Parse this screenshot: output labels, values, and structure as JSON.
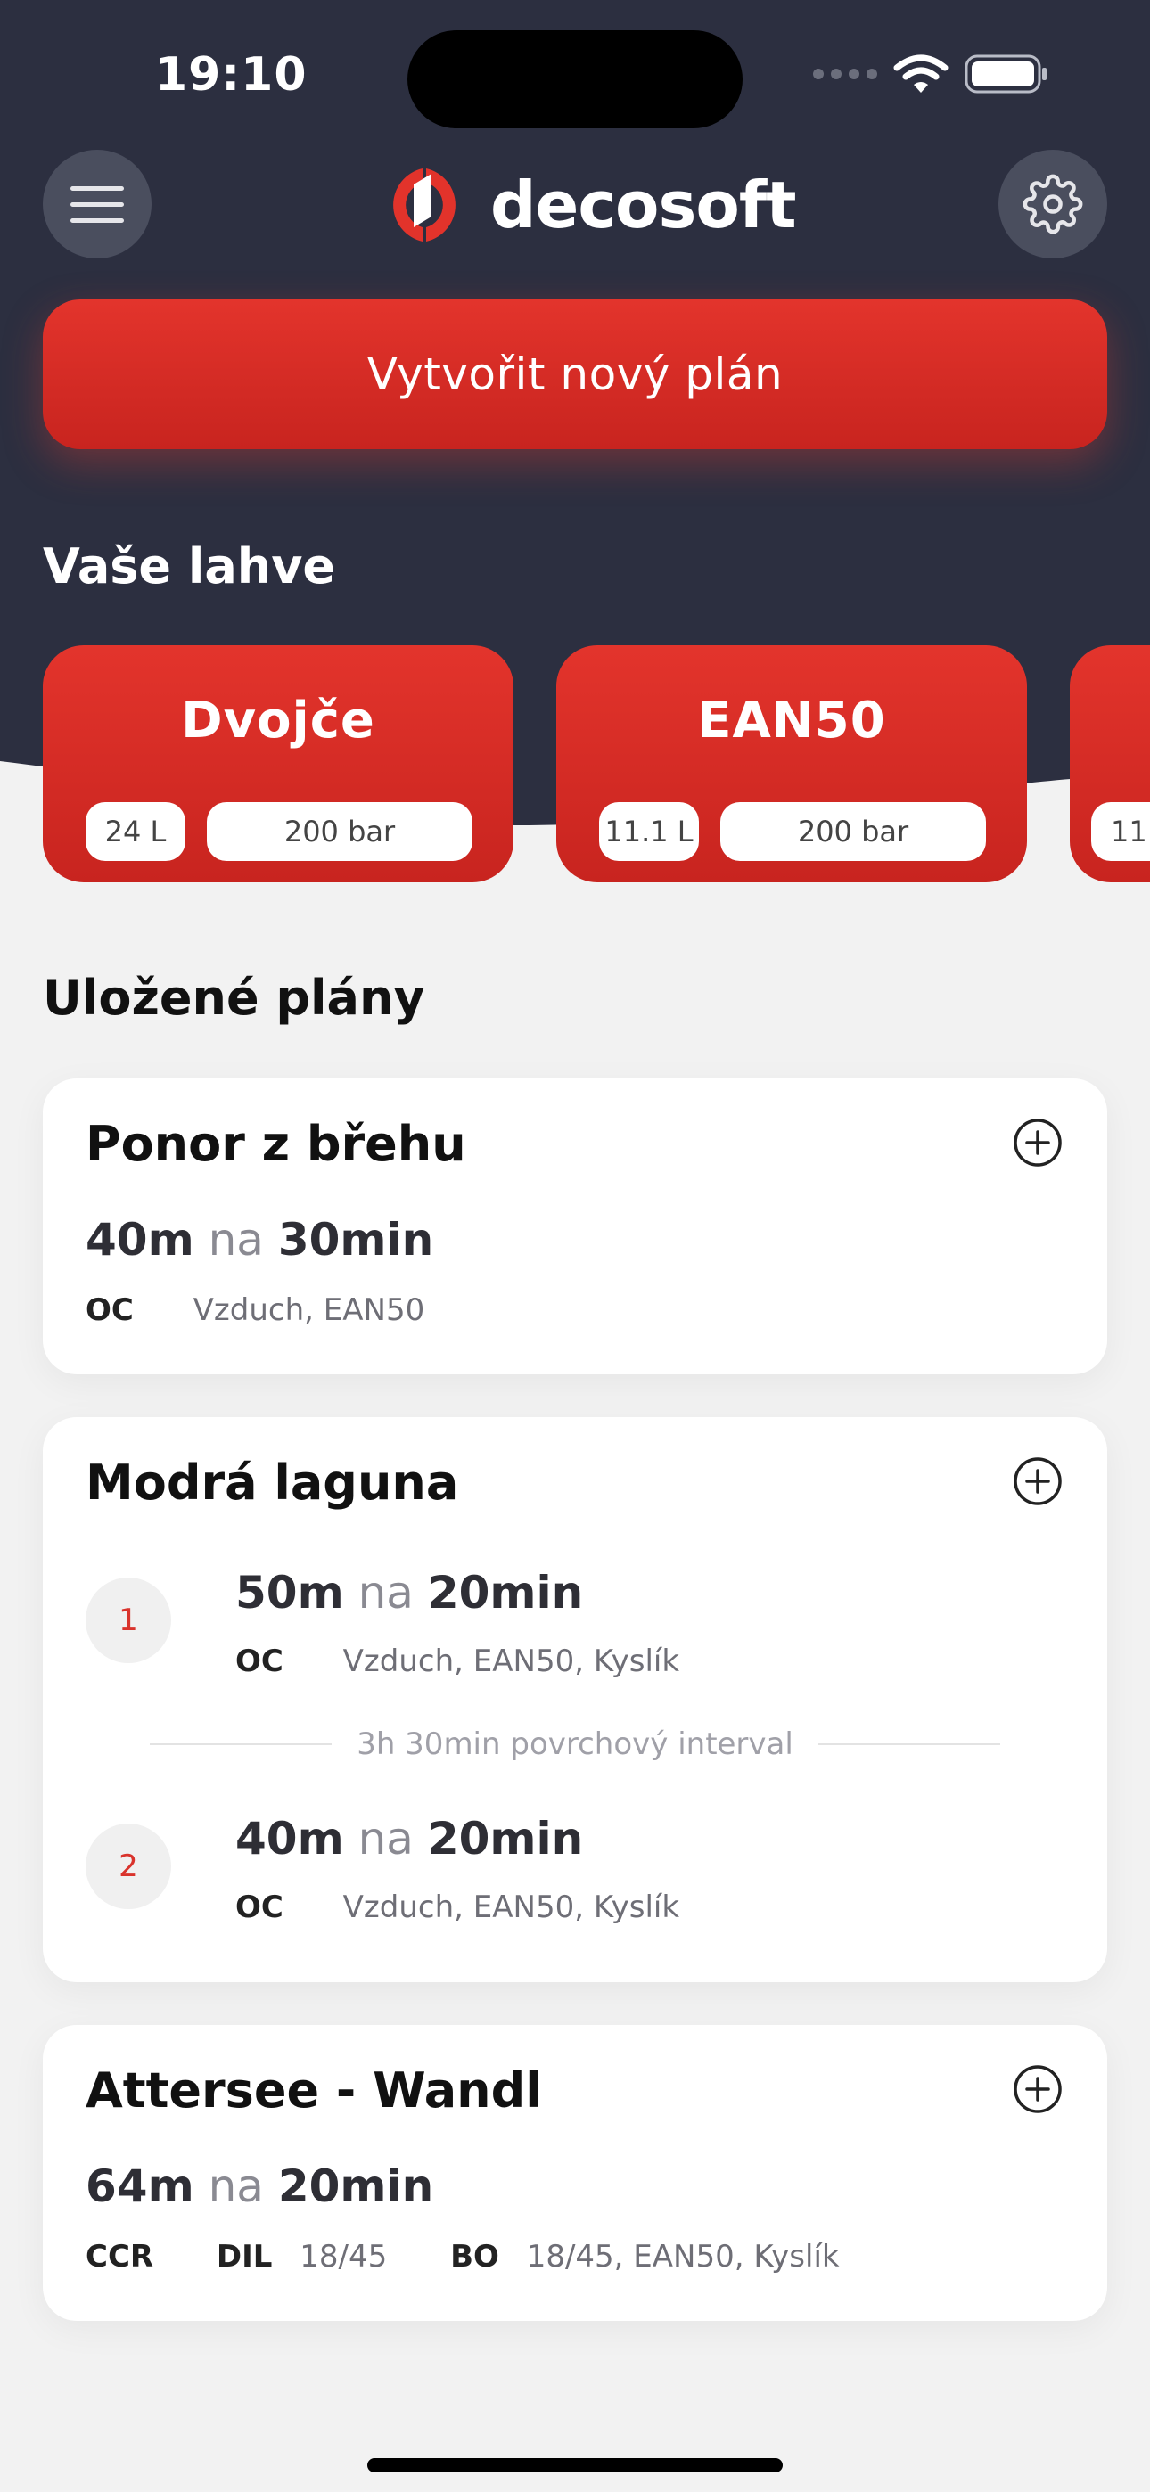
{
  "status_bar": {
    "time": "19:10"
  },
  "app": {
    "name": "decosoft"
  },
  "actions": {
    "new_plan_label": "Vytvořit nový plán"
  },
  "bottles": {
    "title": "Vaše lahve",
    "items": [
      {
        "name": "Dvojče",
        "volume": "24 L",
        "pressure": "200 bar"
      },
      {
        "name": "EAN50",
        "volume": "11.1 L",
        "pressure": "200 bar"
      },
      {
        "name": "",
        "volume": "11",
        "pressure": ""
      }
    ]
  },
  "plans": {
    "title": "Uložené plány",
    "items": [
      {
        "name": "Ponor z břehu",
        "dives": [
          {
            "depth": "40m",
            "na": "na",
            "time": "30min",
            "mode": "OC",
            "gases": "Vzduch, EAN50"
          }
        ]
      },
      {
        "name": "Modrá laguna",
        "dives": [
          {
            "number": "1",
            "depth": "50m",
            "na": "na",
            "time": "20min",
            "mode": "OC",
            "gases": "Vzduch, EAN50, Kyslík"
          },
          {
            "number": "2",
            "depth": "40m",
            "na": "na",
            "time": "20min",
            "mode": "OC",
            "gases": "Vzduch, EAN50, Kyslík"
          }
        ],
        "surface_interval": "3h 30min povrchový interval"
      },
      {
        "name": "Attersee - Wandl",
        "dives": [
          {
            "depth": "64m",
            "na": "na",
            "time": "20min",
            "mode": "CCR",
            "dil_label": "DIL",
            "dil": "18/45",
            "bo_label": "BO",
            "bo": "18/45, EAN50, Kyslík"
          }
        ]
      }
    ]
  },
  "icons": {
    "menu": "hamburger-icon",
    "settings": "gear-icon",
    "add": "plus-circle-icon",
    "logo": "decosoft-logo-icon",
    "wifi": "wifi-icon",
    "battery": "battery-icon",
    "signal": "signal-dots-icon"
  },
  "colors": {
    "header_bg": "#2c2f40",
    "accent": "#e0332b",
    "page_bg": "#f2f2f2",
    "card_bg": "#ffffff"
  }
}
